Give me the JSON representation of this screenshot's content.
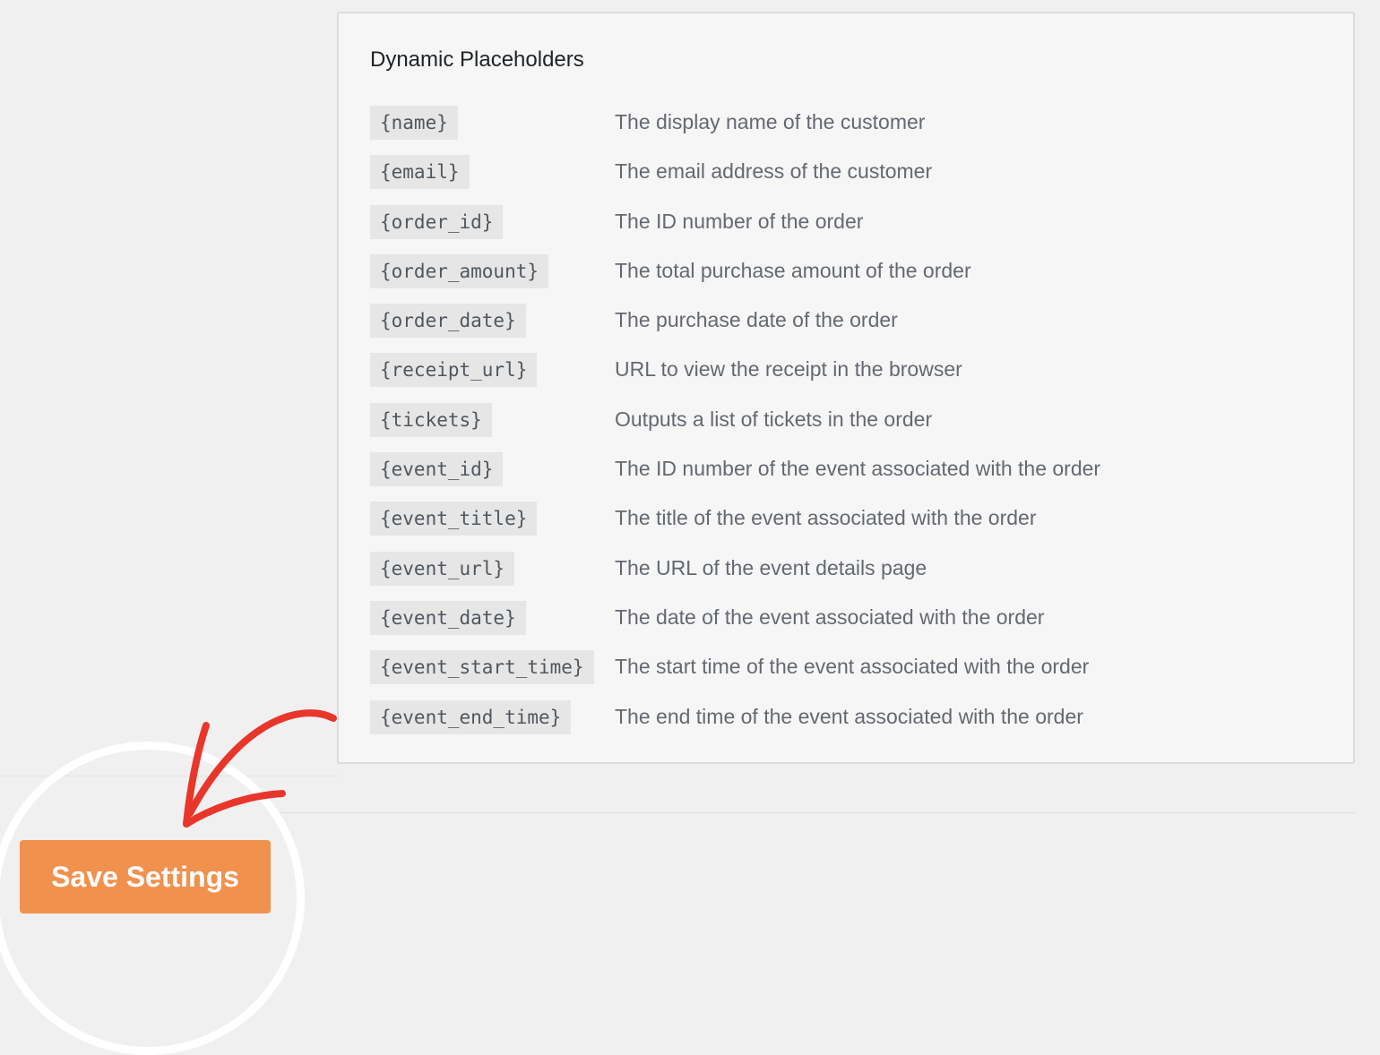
{
  "panel": {
    "title": "Dynamic Placeholders"
  },
  "placeholders": [
    {
      "code": "{name}",
      "description": "The display name of the customer"
    },
    {
      "code": "{email}",
      "description": "The email address of the customer"
    },
    {
      "code": "{order_id}",
      "description": "The ID number of the order"
    },
    {
      "code": "{order_amount}",
      "description": "The total purchase amount of the order"
    },
    {
      "code": "{order_date}",
      "description": "The purchase date of the order"
    },
    {
      "code": "{receipt_url}",
      "description": "URL to view the receipt in the browser"
    },
    {
      "code": "{tickets}",
      "description": "Outputs a list of tickets in the order"
    },
    {
      "code": "{event_id}",
      "description": "The ID number of the event associated with the order"
    },
    {
      "code": "{event_title}",
      "description": "The title of the event associated with the order"
    },
    {
      "code": "{event_url}",
      "description": "The URL of the event details page"
    },
    {
      "code": "{event_date}",
      "description": "The date of the event associated with the order"
    },
    {
      "code": "{event_start_time}",
      "description": "The start time of the event associated with the order"
    },
    {
      "code": "{event_end_time}",
      "description": "The end time of the event associated with the order"
    }
  ],
  "actions": {
    "save_label": "Save Settings"
  },
  "colors": {
    "page_background": "#f0f0f1",
    "panel_background": "#f6f6f6",
    "code_background": "#e6e6e6",
    "save_button": "#f1914e",
    "annotation_arrow": "#e8372a",
    "highlight_circle": "#ffffff"
  }
}
